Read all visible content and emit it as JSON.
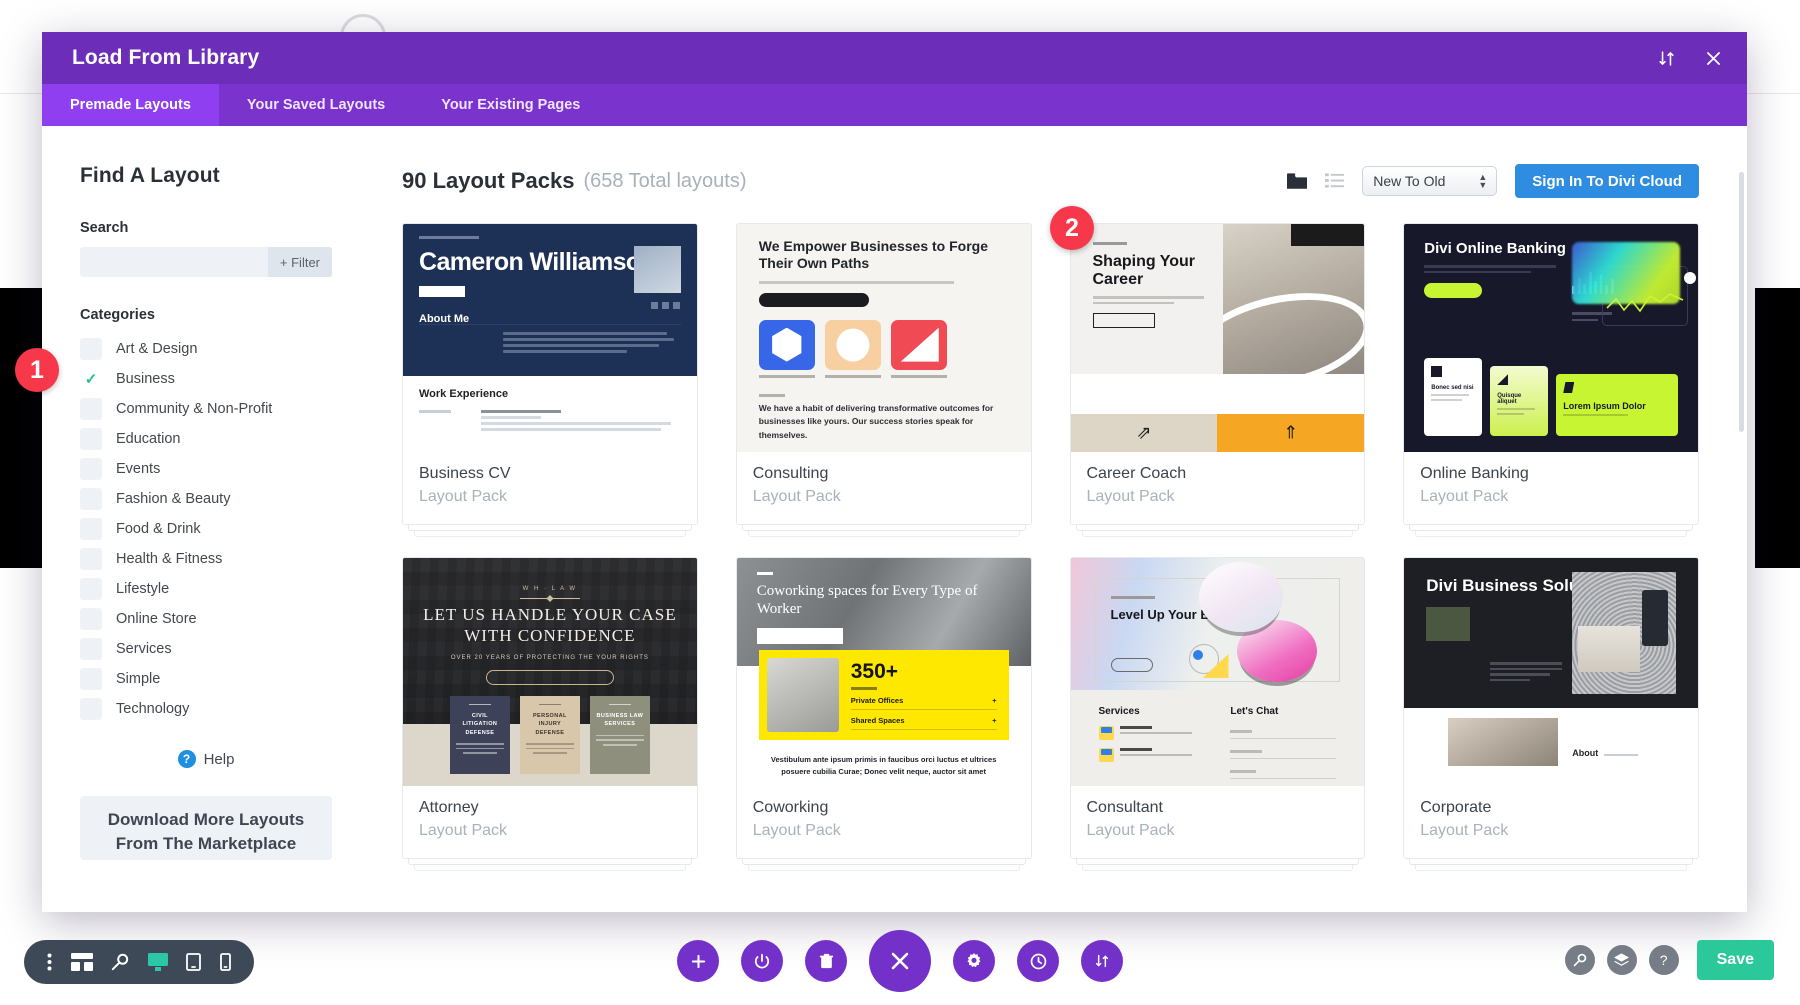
{
  "modal": {
    "title": "Load From Library",
    "header_icons": [
      {
        "name": "sort-toggle-icon",
        "glyph": "⇅"
      },
      {
        "name": "close-icon",
        "glyph": "✕"
      }
    ],
    "tabs": [
      {
        "label": "Premade Layouts",
        "active": true
      },
      {
        "label": "Your Saved Layouts",
        "active": false
      },
      {
        "label": "Your Existing Pages",
        "active": false
      }
    ]
  },
  "sidebar": {
    "heading": "Find A Layout",
    "search_label": "Search",
    "search_value": "",
    "search_placeholder": "",
    "filter_button": "+ Filter",
    "categories_label": "Categories",
    "categories": [
      {
        "label": "Art & Design",
        "checked": false
      },
      {
        "label": "Business",
        "checked": true
      },
      {
        "label": "Community & Non-Profit",
        "checked": false
      },
      {
        "label": "Education",
        "checked": false
      },
      {
        "label": "Events",
        "checked": false
      },
      {
        "label": "Fashion & Beauty",
        "checked": false
      },
      {
        "label": "Food & Drink",
        "checked": false
      },
      {
        "label": "Health & Fitness",
        "checked": false
      },
      {
        "label": "Lifestyle",
        "checked": false
      },
      {
        "label": "Online Store",
        "checked": false
      },
      {
        "label": "Services",
        "checked": false
      },
      {
        "label": "Simple",
        "checked": false
      },
      {
        "label": "Technology",
        "checked": false
      }
    ],
    "help_label": "Help",
    "help_icon_glyph": "?",
    "marketplace_line1": "Download More Layouts",
    "marketplace_line2": "From The Marketplace"
  },
  "main": {
    "pack_count": "90 Layout Packs",
    "total_layouts": "(658 Total layouts)",
    "view_grid_icon": "folder-view-icon",
    "view_list_icon": "list-view-icon",
    "sort_value": "New To Old",
    "signin_button": "Sign In To Divi Cloud",
    "cards": [
      {
        "title": "Business CV",
        "subtitle": "Layout Pack",
        "art": "business-cv",
        "preview_text": {
          "name": "Cameron Williamson",
          "section": "About Me",
          "section2": "Work Experience"
        }
      },
      {
        "title": "Consulting",
        "subtitle": "Layout Pack",
        "art": "consulting",
        "preview_text": {
          "headline": "We Empower Businesses to Forge Their Own Paths",
          "body": "We have a habit of delivering transformative outcomes for businesses like yours. Our success stories speak for themselves."
        }
      },
      {
        "title": "Career Coach",
        "subtitle": "Layout Pack",
        "art": "career-coach",
        "preview_text": {
          "headline": "Shaping Your Career"
        }
      },
      {
        "title": "Online Banking",
        "subtitle": "Layout Pack",
        "art": "online-banking",
        "preview_text": {
          "headline": "Divi Online Banking",
          "card": "Lorem Ipsum Dolor"
        }
      },
      {
        "title": "Attorney",
        "subtitle": "Layout Pack",
        "art": "attorney",
        "preview_text": {
          "headline": "LET US HANDLE YOUR CASE WITH CONFIDENCE"
        }
      },
      {
        "title": "Coworking",
        "subtitle": "Layout Pack",
        "art": "coworking",
        "preview_text": {
          "headline": "Coworking spaces for Every Type of Worker",
          "stat": "350+",
          "row1": "Private Offices",
          "row2": "Shared Spaces",
          "body": "Vestibulum ante ipsum primis in faucibus orci luctus et ultrices posuere cubilia Curae; Donec velit neque, auctor sit amet"
        }
      },
      {
        "title": "Consultant",
        "subtitle": "Layout Pack",
        "art": "consultant",
        "preview_text": {
          "headline": "Level Up Your Business",
          "col1": "Services",
          "col2": "Let's Chat"
        }
      },
      {
        "title": "Corporate",
        "subtitle": "Layout Pack",
        "art": "corporate",
        "preview_text": {
          "headline": "Divi Business Solutions",
          "about": "About"
        }
      }
    ]
  },
  "annotations": [
    {
      "number": "1",
      "color": "#f6384a"
    },
    {
      "number": "2",
      "color": "#f6384a"
    }
  ],
  "bottom_bar": {
    "left_tools": [
      {
        "name": "more-options-icon"
      },
      {
        "name": "wireframe-view-icon"
      },
      {
        "name": "zoom-view-icon"
      },
      {
        "name": "desktop-view-icon",
        "active": true
      },
      {
        "name": "tablet-view-icon"
      },
      {
        "name": "phone-view-icon"
      }
    ],
    "center_tools": [
      {
        "name": "add-section-icon"
      },
      {
        "name": "power-toggle-icon"
      },
      {
        "name": "trash-icon"
      },
      {
        "name": "close-builder-icon",
        "primary": true
      },
      {
        "name": "settings-gear-icon"
      },
      {
        "name": "history-clock-icon"
      },
      {
        "name": "load-library-icon"
      }
    ],
    "right_tools": [
      {
        "name": "search-icon"
      },
      {
        "name": "layers-icon"
      },
      {
        "name": "help-icon"
      }
    ],
    "save_label": "Save"
  },
  "colors": {
    "modal_header": "#6c2eb9",
    "tabs_bar": "#7a33cc",
    "tab_active": "#8f3ef0",
    "accent_blue": "#2e8de0",
    "checkmark_green": "#25c18c",
    "badge_red": "#f6384a",
    "save_green": "#2bc99a"
  }
}
